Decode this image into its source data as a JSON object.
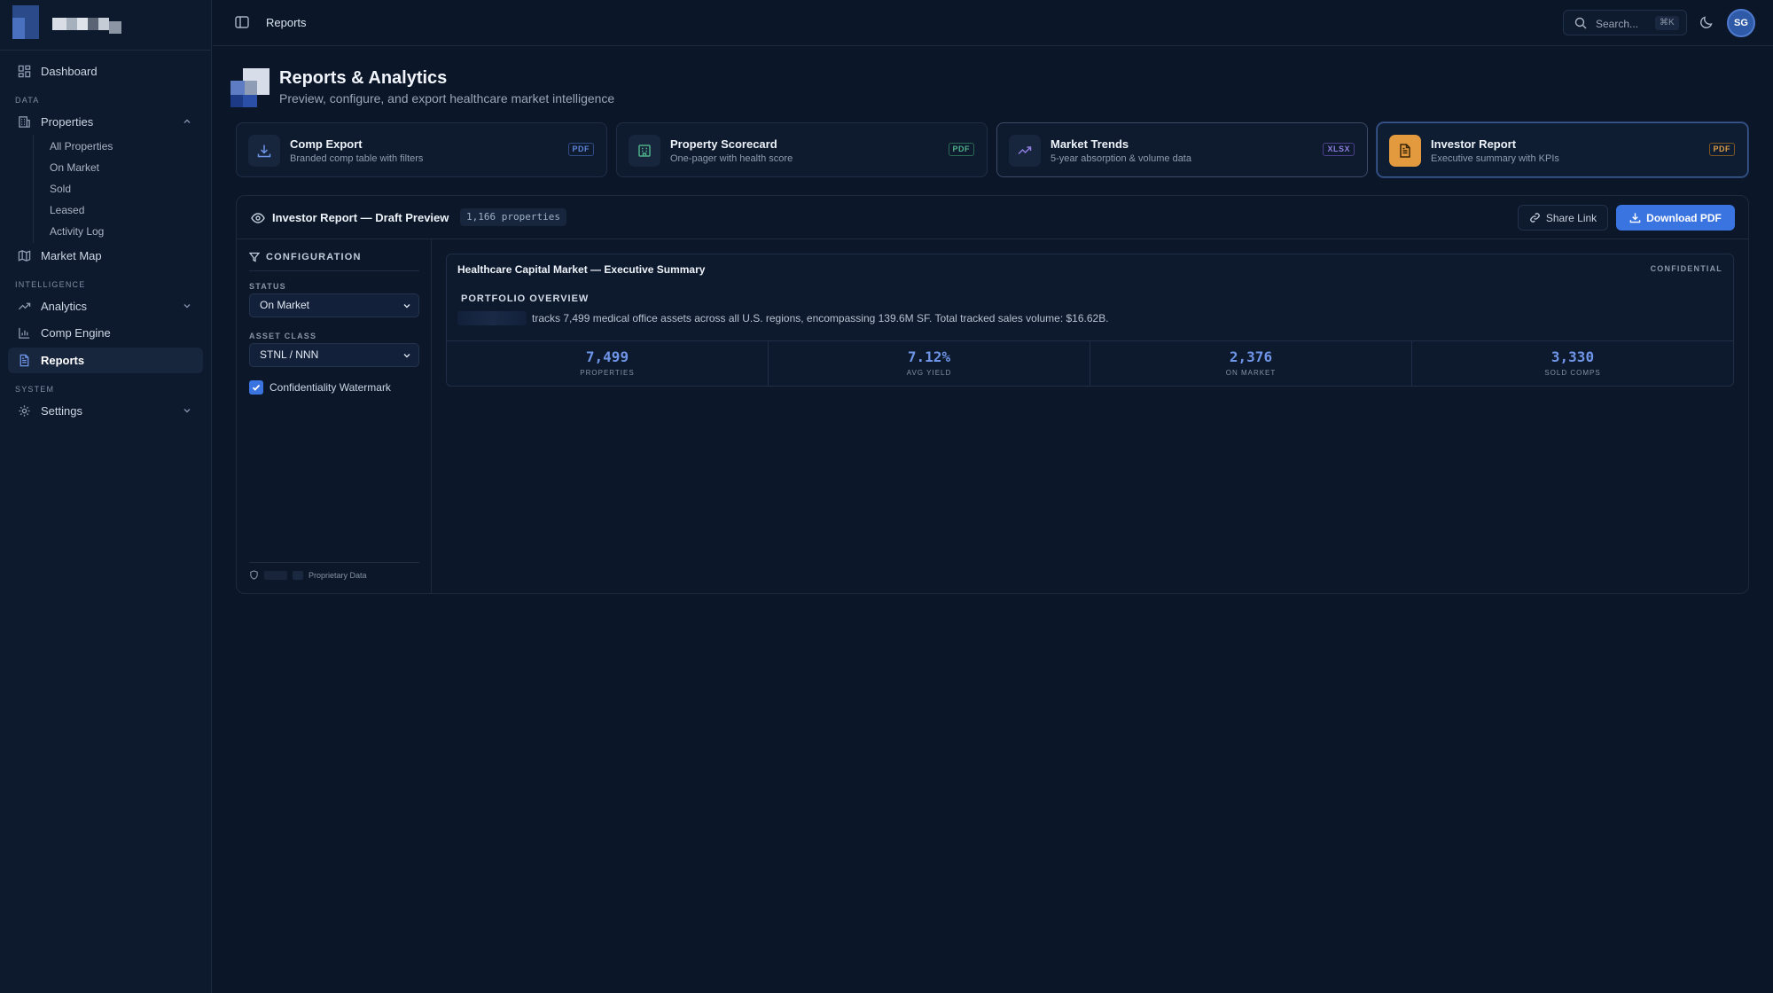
{
  "topbar": {
    "breadcrumb": "Reports",
    "search_placeholder": "Search...",
    "search_shortcut": "⌘K",
    "avatar_initials": "SG"
  },
  "sidebar": {
    "dashboard": "Dashboard",
    "section_data": "DATA",
    "properties": "Properties",
    "properties_sub": [
      "All Properties",
      "On Market",
      "Sold",
      "Leased",
      "Activity Log"
    ],
    "market_map": "Market Map",
    "section_intelligence": "INTELLIGENCE",
    "analytics": "Analytics",
    "comp_engine": "Comp Engine",
    "reports": "Reports",
    "section_system": "SYSTEM",
    "settings": "Settings"
  },
  "header": {
    "title": "Reports & Analytics",
    "subtitle": "Preview, configure, and export healthcare market intelligence"
  },
  "report_types": [
    {
      "name": "Comp Export",
      "desc": "Branded comp table with filters",
      "format": "PDF",
      "icon": "download-icon"
    },
    {
      "name": "Property Scorecard",
      "desc": "One-pager with health score",
      "format": "PDF",
      "icon": "building-icon"
    },
    {
      "name": "Market Trends",
      "desc": "5-year absorption & volume data",
      "format": "XLSX",
      "icon": "trending-up-icon"
    },
    {
      "name": "Investor Report",
      "desc": "Executive summary with KPIs",
      "format": "PDF",
      "icon": "document-icon"
    }
  ],
  "preview": {
    "title": "Investor Report — Draft Preview",
    "count_badge": "1,166 properties",
    "share_label": "Share Link",
    "download_label": "Download PDF",
    "config": {
      "title": "CONFIGURATION",
      "status_label": "STATUS",
      "status_value": "On Market",
      "asset_label": "ASSET CLASS",
      "asset_value": "STNL / NNN",
      "watermark_label": "Confidentiality Watermark",
      "watermark_checked": true,
      "footer": "Proprietary Data"
    },
    "summary": {
      "title": "Healthcare Capital Market — Executive Summary",
      "confidential": "CONFIDENTIAL",
      "overview_label": "PORTFOLIO OVERVIEW",
      "overview_text": "tracks 7,499 medical office assets across all U.S. regions, encompassing 139.6M SF. Total tracked sales volume: $16.62B.",
      "kpis": [
        {
          "value": "7,499",
          "label": "PROPERTIES"
        },
        {
          "value": "7.12%",
          "label": "AVG YIELD"
        },
        {
          "value": "2,376",
          "label": "ON MARKET"
        },
        {
          "value": "3,330",
          "label": "SOLD COMPS"
        }
      ]
    }
  },
  "colors": {
    "background": "#0b1628",
    "accent": "#3a74e0",
    "kpi_value": "#6f95e8",
    "investor_icon": "#e39a3e"
  }
}
